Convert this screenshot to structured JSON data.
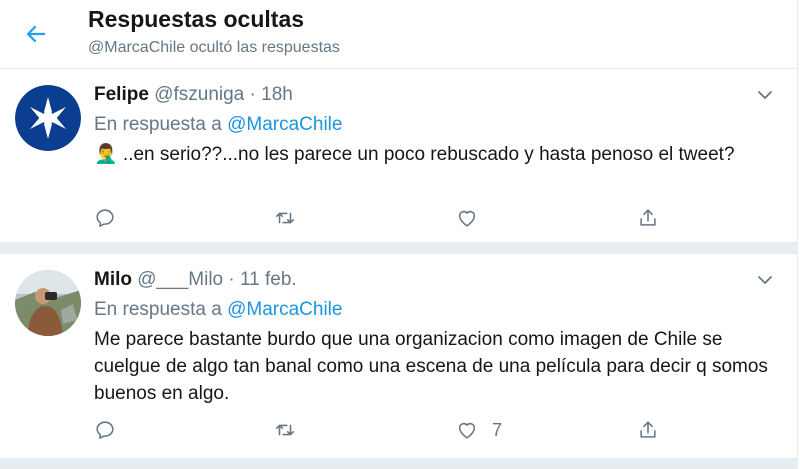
{
  "header": {
    "title": "Respuestas ocultas",
    "subtitle": "@MarcaChile ocultó las respuestas"
  },
  "tweets": [
    {
      "name": "Felipe",
      "handle": "@fszuniga",
      "dot": "·",
      "time": "18h",
      "reply_prefix": "En respuesta a",
      "reply_to": "@MarcaChile",
      "text": "🤦‍♂️ ..en serio??...no les parece un poco rebuscado y hasta penoso el tweet?",
      "like_count": ""
    },
    {
      "name": "Milo",
      "handle": "@___Milo",
      "dot": "·",
      "time": "11 feb.",
      "reply_prefix": "En respuesta a",
      "reply_to": "@MarcaChile",
      "text": "Me parece bastante burdo que una organizacion como imagen de Chile se cuelgue de algo tan banal como una escena de una película para decir q somos buenos en algo.",
      "like_count": "7"
    }
  ],
  "colors": {
    "accent": "#1b95e0",
    "muted": "#657786",
    "text": "#14171a",
    "divider": "#e6ecf0",
    "avatar1_bg": "#0b3d91"
  },
  "icons": {
    "back": "arrow-left-icon",
    "reply": "reply-icon",
    "retweet": "retweet-icon",
    "like": "heart-icon",
    "share": "share-icon",
    "menu": "chevron-down-icon"
  }
}
